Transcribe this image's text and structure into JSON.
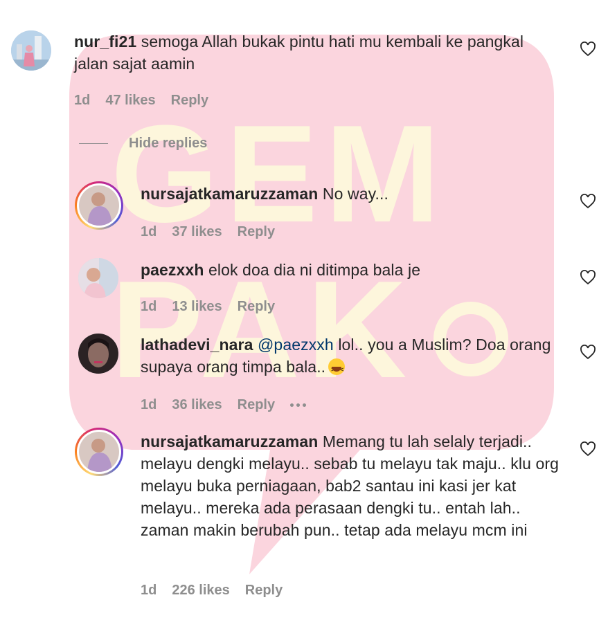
{
  "watermark": {
    "text_top": "GEM",
    "text_bottom": "PAK",
    "bg_color": "#fbd5de",
    "letter_color": "#fdf6dc"
  },
  "hide_replies_label": "Hide replies",
  "colors": {
    "meta": "#8e8e8e",
    "mention": "#00376b",
    "text": "#262626"
  },
  "comments": [
    {
      "username": "nur_fi21",
      "text": "semoga Allah bukak pintu hati mu kembali ke pangkal jalan sajat aamin",
      "time": "1d",
      "likes": "47 likes",
      "reply": "Reply",
      "avatar_icon": "profile-photo"
    },
    {
      "username": "nursajatkamaruzzaman",
      "text": "No way...",
      "time": "1d",
      "likes": "37 likes",
      "reply": "Reply",
      "avatar_icon": "story-ring-profile-photo"
    },
    {
      "username": "paezxxh",
      "text": "elok doa dia ni ditimpa bala je",
      "time": "1d",
      "likes": "13 likes",
      "reply": "Reply",
      "avatar_icon": "profile-photo"
    },
    {
      "username": "lathadevi_nara",
      "mention": "@paezxxh",
      "text": "lol.. you a Muslim? Doa orang supaya orang timpa bala..",
      "emoji": "grinning-squinting-face",
      "time": "1d",
      "likes": "36 likes",
      "reply": "Reply",
      "avatar_icon": "profile-photo"
    },
    {
      "username": "nursajatkamaruzzaman",
      "text": "Memang tu lah selaly terjadi.. melayu dengki melayu.. sebab tu melayu tak maju.. klu org melayu buka perniagaan, bab2 santau ini kasi jer kat melayu.. mereka ada perasaan dengki tu.. entah lah.. zaman makin berubah pun.. tetap ada melayu mcm ini",
      "time": "1d",
      "likes": "226 likes",
      "reply": "Reply",
      "avatar_icon": "story-ring-profile-photo"
    }
  ]
}
